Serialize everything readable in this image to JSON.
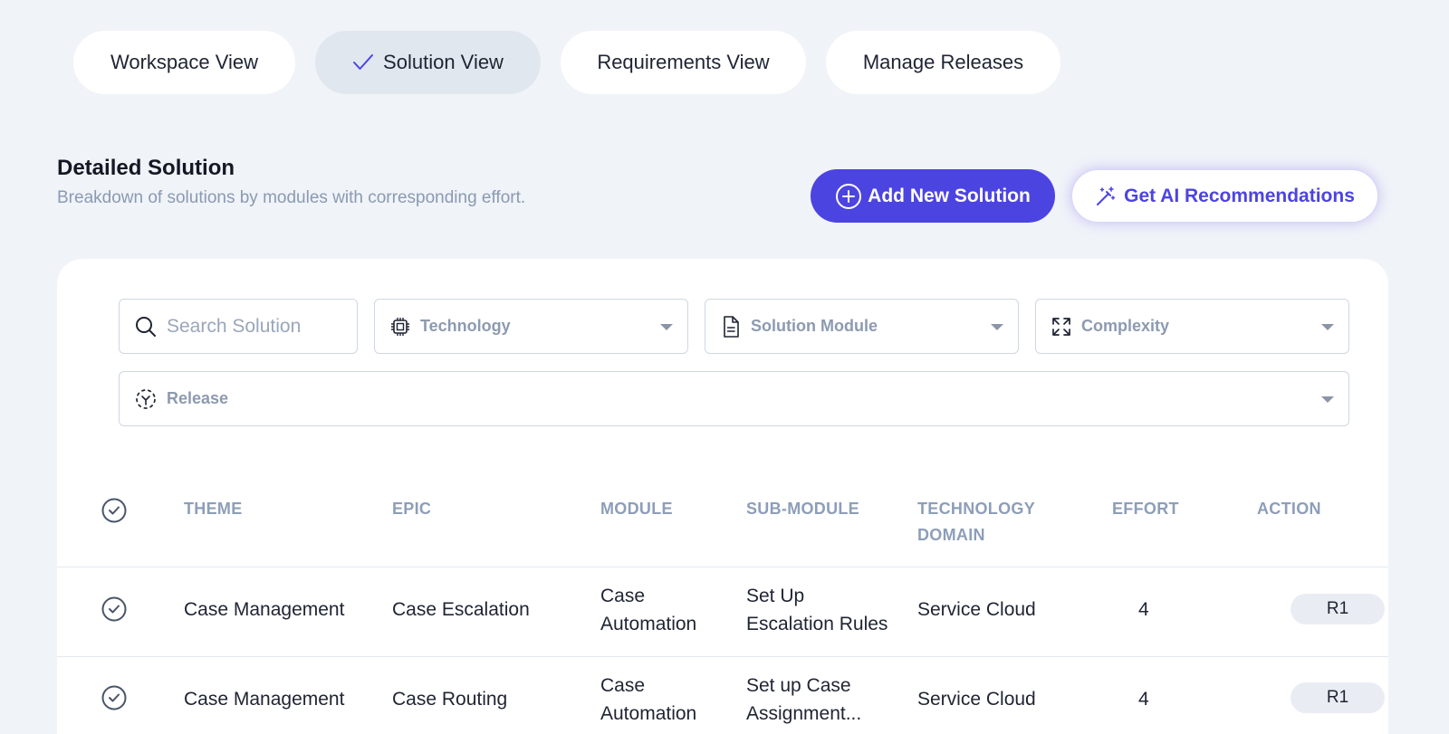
{
  "tabs": [
    {
      "label": "Workspace View",
      "active": false
    },
    {
      "label": "Solution View",
      "active": true
    },
    {
      "label": "Requirements View",
      "active": false
    },
    {
      "label": "Manage Releases",
      "active": false
    }
  ],
  "section": {
    "title": "Detailed Solution",
    "subtitle": "Breakdown of solutions by modules with corresponding effort."
  },
  "actions": {
    "add_label": "Add New Solution",
    "ai_label": "Get AI Recommendations"
  },
  "filters": {
    "search_placeholder": "Search Solution",
    "technology": "Technology",
    "solution_module": "Solution Module",
    "complexity": "Complexity",
    "release": "Release"
  },
  "table": {
    "headers": {
      "theme": "THEME",
      "epic": "EPIC",
      "module": "MODULE",
      "sub_module": "SUB-MODULE",
      "technology_domain_1": "TECHNOLOGY",
      "technology_domain_2": "DOMAIN",
      "effort": "EFFORT",
      "action": "ACTION"
    },
    "rows": [
      {
        "theme": "Case Management",
        "epic": "Case Escalation",
        "module_1": "Case",
        "module_2": "Automation",
        "sub_module_1": "Set Up",
        "sub_module_2": "Escalation Rules",
        "technology_domain": "Service Cloud",
        "effort": "4",
        "release": "R1"
      },
      {
        "theme": "Case Management",
        "epic": "Case Routing",
        "module_1": "Case",
        "module_2": "Automation",
        "sub_module_1": "Set up Case",
        "sub_module_2": "Assignment...",
        "technology_domain": "Service Cloud",
        "effort": "4",
        "release": "R1"
      }
    ]
  },
  "colors": {
    "accent": "#4c44e0",
    "background": "#f0f3f8",
    "active_tab": "#e1e7ef",
    "muted_text": "#8d9eb8"
  }
}
